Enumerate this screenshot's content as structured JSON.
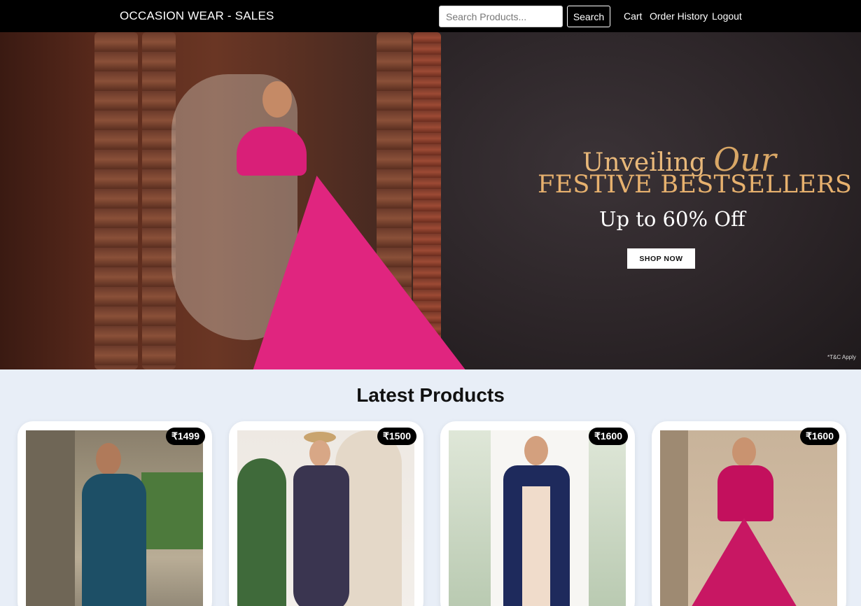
{
  "navbar": {
    "brand": "OCCASION WEAR - SALES",
    "search_placeholder": "Search Products...",
    "search_label": "Search",
    "links": [
      "Cart",
      "Order History",
      "Logout"
    ]
  },
  "hero": {
    "line1": "Unveiling",
    "line1_accent": "Our",
    "title": "FESTIVE BESTSELLERS",
    "subtitle": "Up to 60% Off",
    "cta": "SHOP NOW",
    "tnc": "*T&C Apply"
  },
  "latest": {
    "title": "Latest Products",
    "products": [
      {
        "price": "₹1499"
      },
      {
        "price": "₹1500"
      },
      {
        "price": "₹1600"
      },
      {
        "price": "₹1600"
      }
    ]
  }
}
